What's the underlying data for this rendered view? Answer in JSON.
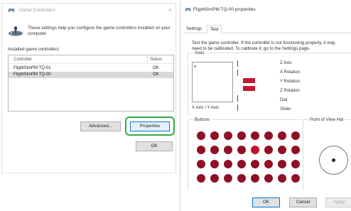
{
  "colors": {
    "accent_blue": "#0078d7",
    "highlight_green": "#36a845",
    "button_dot": "#8f1025",
    "button_dot_pressed": "#c01028",
    "axis_red": "#c21836",
    "selected_row": "#d9d9d9"
  },
  "game_controllers": {
    "title": "Game Controllers",
    "title_icon": "gamepad-icon",
    "close_glyph": "×",
    "header_icon": "joystick-icon",
    "header_text": "These settings help you configure the game controllers installed on your computer.",
    "installed_label": "Installed game controllers",
    "columns": {
      "controller": "Controller",
      "status": "Status"
    },
    "rows": [
      {
        "controller": "FlightSimPM TQ-01",
        "status": "OK",
        "selected": false
      },
      {
        "controller": "FlightSimPM TQ-00",
        "status": "OK",
        "selected": true
      }
    ],
    "buttons": {
      "advanced": "Advanced...",
      "properties": "Properties",
      "ok": "OK"
    }
  },
  "properties": {
    "title": "FlightSimPM TQ-00 properties",
    "title_icon": "gamepad-icon",
    "tabs": [
      "Settings",
      "Test"
    ],
    "active_tab": "Test",
    "description_line1": "Test the game controller.  If the controller is not functioning properly, it may",
    "description_line2": "need to be calibrated.  To calibrate it, go to the Settings page.",
    "axes": {
      "label": "Axes",
      "xy_label": "X Axis / Y Axis",
      "names": [
        "Z Axis",
        "X Rotation",
        "Y Rotation",
        "Z Rotation",
        "Dial",
        "Slider"
      ]
    },
    "buttons_group": {
      "label": "Buttons",
      "rows": 4,
      "cols": 8,
      "pressed_index": 12
    },
    "pov": {
      "label": "Point of View Hat"
    },
    "footer": {
      "ok": "OK",
      "cancel": "Cancel",
      "apply": "Apply"
    }
  }
}
